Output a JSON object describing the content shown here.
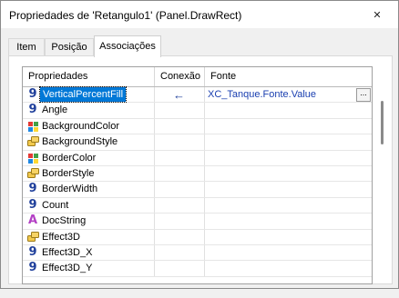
{
  "window": {
    "title": "Propriedades de 'Retangulo1' (Panel.DrawRect)",
    "close_glyph": "✕"
  },
  "tabs": [
    {
      "label": "Item",
      "active": false
    },
    {
      "label": "Posição",
      "active": false
    },
    {
      "label": "Associações",
      "active": true
    }
  ],
  "grid": {
    "columns": [
      "Propriedades",
      "Conexão",
      "Fonte"
    ],
    "rows": [
      {
        "name": "VerticalPercentFill",
        "icon": "number-icon",
        "selected": true,
        "connection": "←",
        "fonte": "XC_Tanque.Fonte.Value",
        "has_button": true,
        "button_label": "..."
      },
      {
        "name": "Angle",
        "icon": "number-icon"
      },
      {
        "name": "BackgroundColor",
        "icon": "color-icon"
      },
      {
        "name": "BackgroundStyle",
        "icon": "enum-icon"
      },
      {
        "name": "BorderColor",
        "icon": "color-icon"
      },
      {
        "name": "BorderStyle",
        "icon": "enum-icon"
      },
      {
        "name": "BorderWidth",
        "icon": "number-icon"
      },
      {
        "name": "Count",
        "icon": "number-icon"
      },
      {
        "name": "DocString",
        "icon": "string-icon"
      },
      {
        "name": "Effect3D",
        "icon": "enum-icon"
      },
      {
        "name": "Effect3D_X",
        "icon": "number-icon"
      },
      {
        "name": "Effect3D_Y",
        "icon": "number-icon"
      }
    ]
  },
  "icon_glyphs": {
    "number": "9",
    "string": "A"
  },
  "colors": {
    "selection": "#0078d7",
    "number_icon": "#1f3f9b",
    "string_icon": "#b340c4",
    "link": "#1a3fb0"
  }
}
